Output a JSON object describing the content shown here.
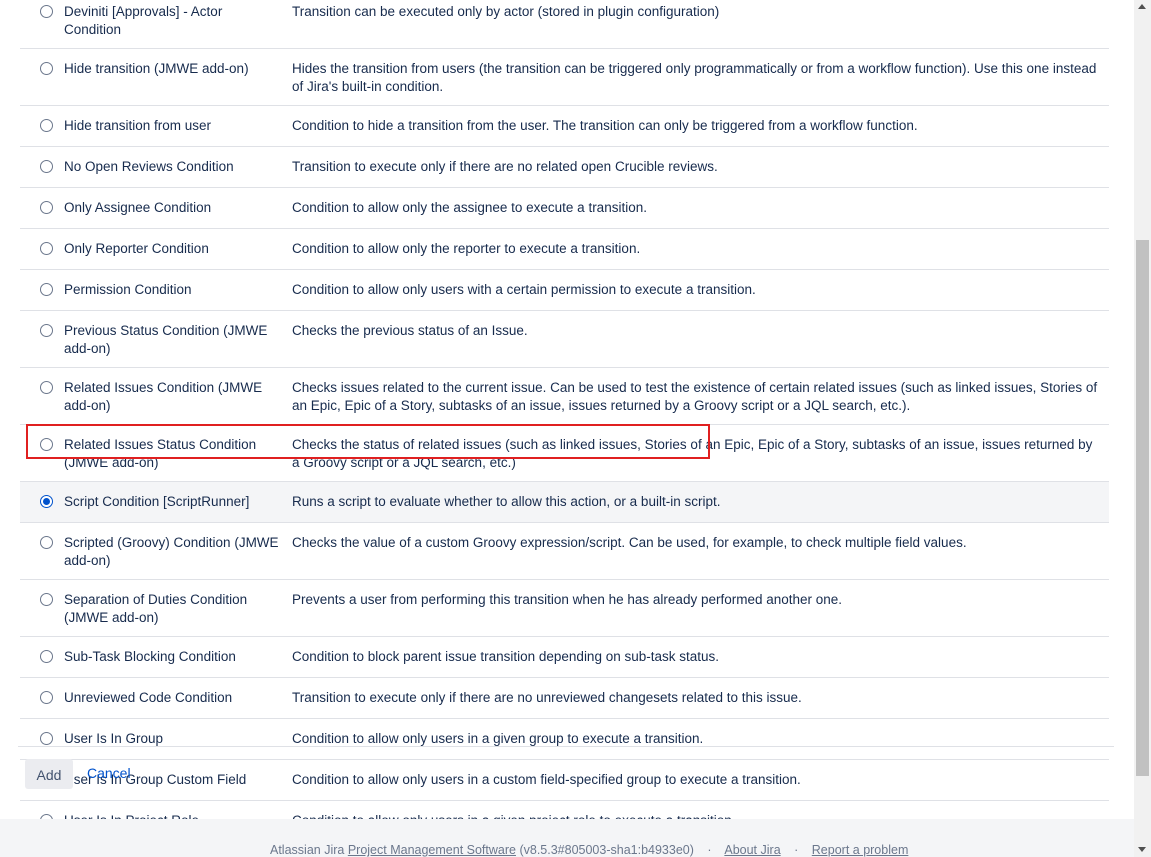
{
  "conditions": [
    {
      "name": "Deviniti [Approvals] - Actor Condition",
      "description": "Transition can be executed only by actor (stored in plugin configuration)",
      "selected": false
    },
    {
      "name": "Hide transition (JMWE add-on)",
      "description": "Hides the transition from users (the transition can be triggered only programmatically or from a workflow function). Use this one instead of Jira's built-in condition.",
      "selected": false
    },
    {
      "name": "Hide transition from user",
      "description": "Condition to hide a transition from the user. The transition can only be triggered from a workflow function.",
      "selected": false
    },
    {
      "name": "No Open Reviews Condition",
      "description": "Transition to execute only if there are no related open Crucible reviews.",
      "selected": false
    },
    {
      "name": "Only Assignee Condition",
      "description": "Condition to allow only the assignee to execute a transition.",
      "selected": false
    },
    {
      "name": "Only Reporter Condition",
      "description": "Condition to allow only the reporter to execute a transition.",
      "selected": false
    },
    {
      "name": "Permission Condition",
      "description": "Condition to allow only users with a certain permission to execute a transition.",
      "selected": false
    },
    {
      "name": "Previous Status Condition (JMWE add-on)",
      "description": "Checks the previous status of an Issue.",
      "selected": false
    },
    {
      "name": "Related Issues Condition (JMWE add-on)",
      "description": "Checks issues related to the current issue. Can be used to test the existence of certain related issues (such as linked issues, Stories of an Epic, Epic of a Story, subtasks of an issue, issues returned by a Groovy script or a JQL search, etc.).",
      "selected": false
    },
    {
      "name": "Related Issues Status Condition (JMWE add-on)",
      "description": "Checks the status of related issues (such as linked issues, Stories of an Epic, Epic of a Story, subtasks of an issue, issues returned by a Groovy script or a JQL search, etc.)",
      "selected": false
    },
    {
      "name": "Script Condition [ScriptRunner]",
      "description": "Runs a script to evaluate whether to allow this action, or a built-in script.",
      "selected": true
    },
    {
      "name": "Scripted (Groovy) Condition (JMWE add-on)",
      "description": "Checks the value of a custom Groovy expression/script. Can be used, for example, to check multiple field values.",
      "selected": false
    },
    {
      "name": "Separation of Duties Condition (JMWE add-on)",
      "description": "Prevents a user from performing this transition when he has already performed another one.",
      "selected": false
    },
    {
      "name": "Sub-Task Blocking Condition",
      "description": "Condition to block parent issue transition depending on sub-task status.",
      "selected": false
    },
    {
      "name": "Unreviewed Code Condition",
      "description": "Transition to execute only if there are no unreviewed changesets related to this issue.",
      "selected": false
    },
    {
      "name": "User Is In Group",
      "description": "Condition to allow only users in a given group to execute a transition.",
      "selected": false
    },
    {
      "name": "User Is In Group Custom Field",
      "description": "Condition to allow only users in a custom field-specified group to execute a transition.",
      "selected": false
    },
    {
      "name": "User Is In Project Role",
      "description": "Condition to allow only users in a given project role to execute a transition.",
      "selected": false
    }
  ],
  "actions": {
    "add_label": "Add",
    "cancel_label": "Cancel"
  },
  "footer": {
    "prefix": "Atlassian Jira",
    "pms_link": "Project Management Software",
    "version": "(v8.5.3#805003-sha1:b4933e0)",
    "about_link": "About Jira",
    "report_link": "Report a problem",
    "separator": "·"
  },
  "colors": {
    "highlight": "#e02020",
    "radio_selected": "#0052cc",
    "link": "#0052cc"
  }
}
